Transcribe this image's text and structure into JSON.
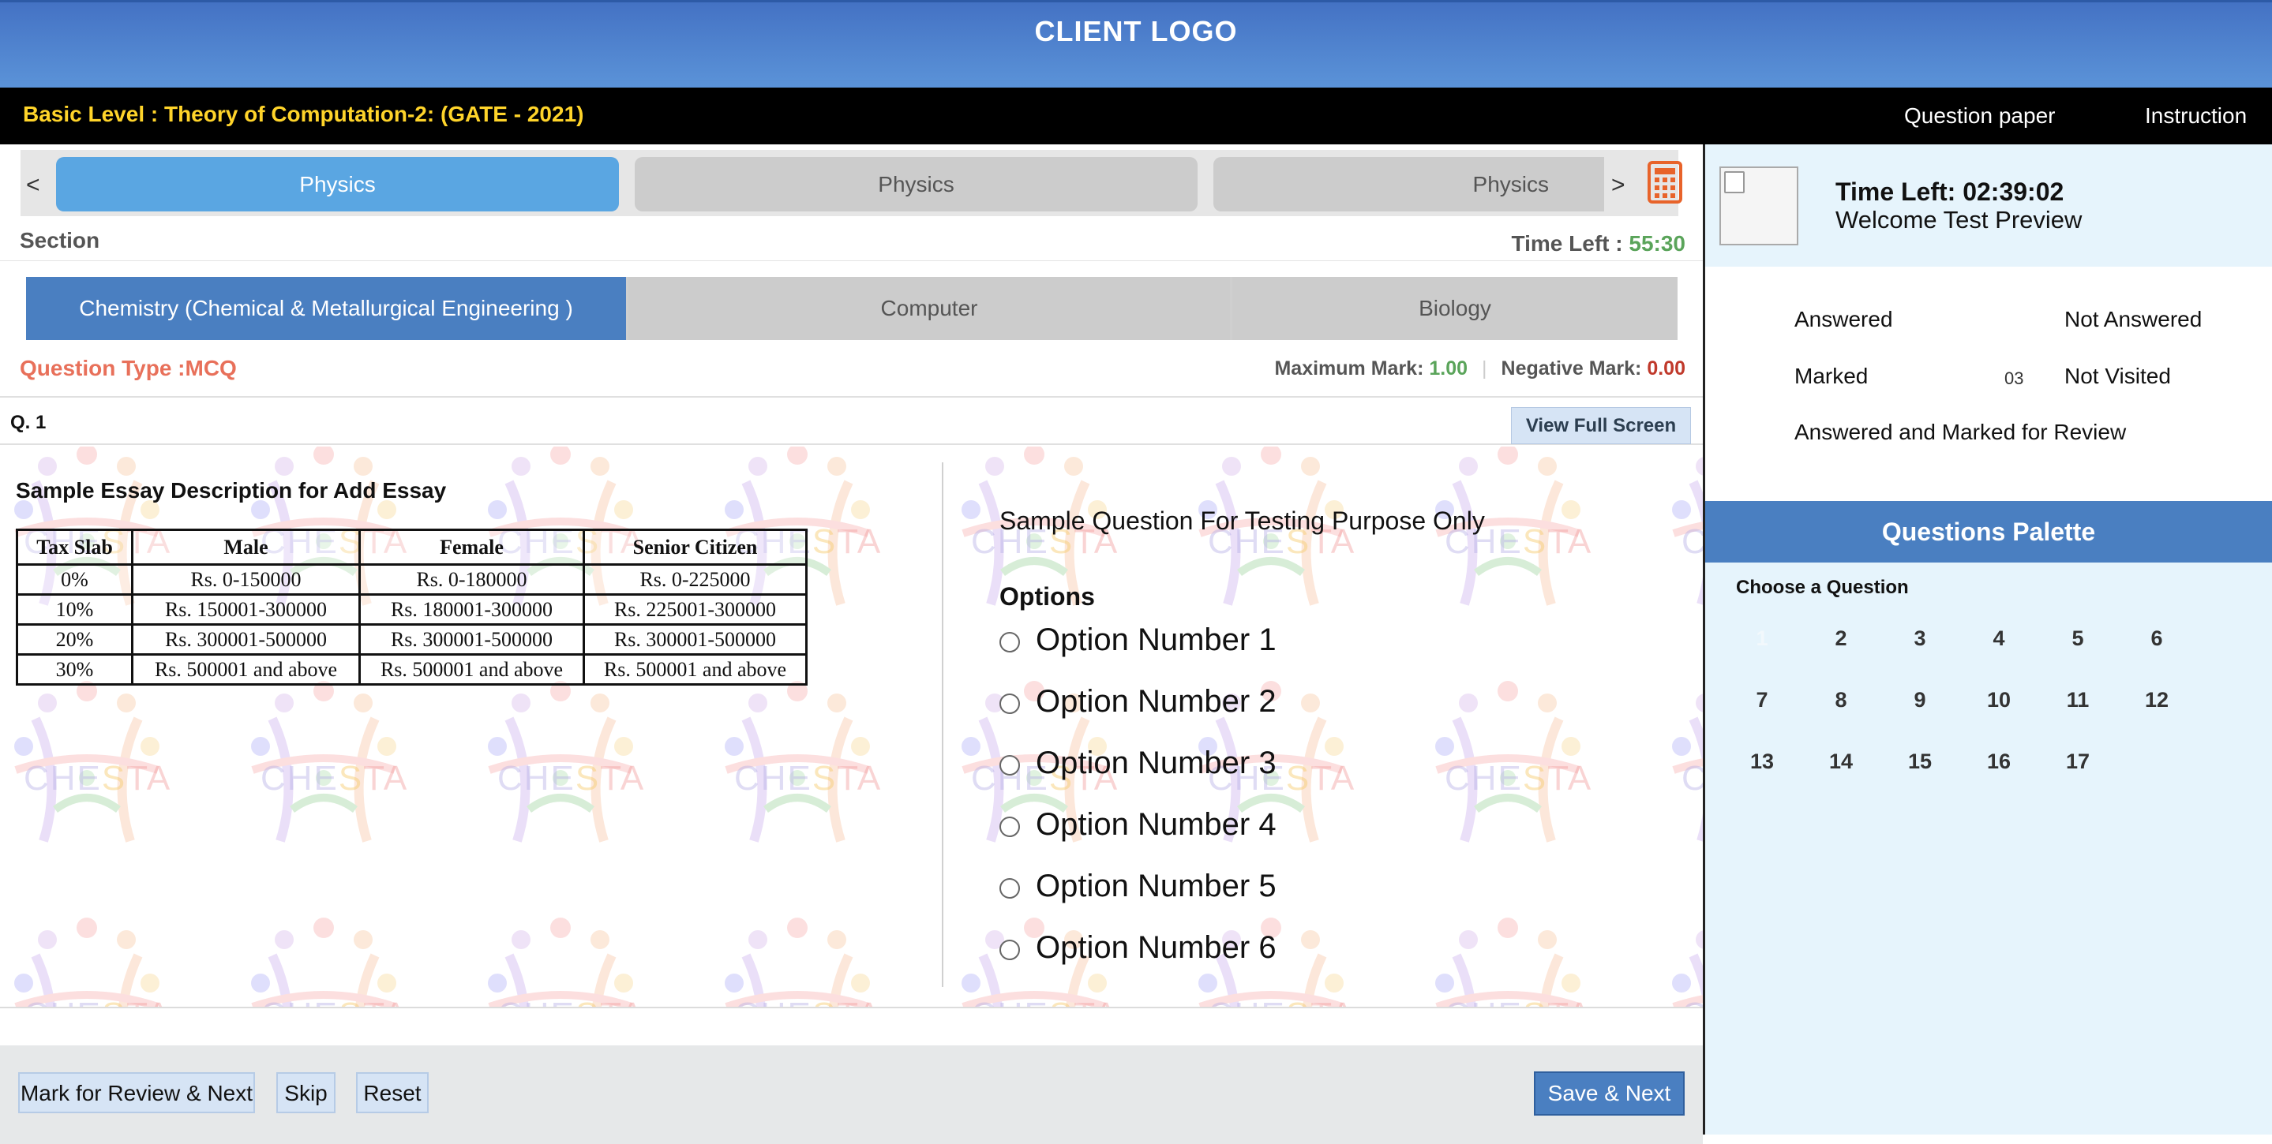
{
  "header": {
    "logo_text": "CLIENT LOGO",
    "exam_title": "Basic Level : Theory of Computation-2: (GATE - 2021)",
    "links": {
      "question_paper": "Question paper",
      "instruction": "Instruction"
    }
  },
  "subjects": {
    "prev": "<",
    "next": ">",
    "tabs": [
      "Physics",
      "Physics",
      "Physics"
    ],
    "active_index": 0
  },
  "section": {
    "label": "Section",
    "time_label": "Time Left : ",
    "time_value": "55:30",
    "tabs": [
      "Chemistry (Chemical & Metallurgical Engineering )",
      "Computer",
      "Biology"
    ],
    "active_index": 0
  },
  "question_meta": {
    "type_label": "Question Type :MCQ",
    "max_mark_label": "Maximum Mark: ",
    "max_mark_value": "1.00",
    "neg_mark_label": "Negative Mark: ",
    "neg_mark_value": "0.00",
    "number": "Q. 1",
    "fullscreen_label": "View Full Screen"
  },
  "essay": {
    "title": "Sample Essay Description for Add Essay",
    "table": {
      "headers": [
        "Tax Slab",
        "Male",
        "Female",
        "Senior Citizen"
      ],
      "rows": [
        [
          "0%",
          "Rs. 0-150000",
          "Rs. 0-180000",
          "Rs. 0-225000"
        ],
        [
          "10%",
          "Rs. 150001-300000",
          "Rs. 180001-300000",
          "Rs. 225001-300000"
        ],
        [
          "20%",
          "Rs. 300001-500000",
          "Rs. 300001-500000",
          "Rs. 300001-500000"
        ],
        [
          "30%",
          "Rs. 500001 and above",
          "Rs. 500001 and above",
          "Rs. 500001 and above"
        ]
      ]
    }
  },
  "question": {
    "text": "Sample Question For Testing Purpose Only",
    "options_heading": "Options",
    "options": [
      "Option Number 1",
      "Option Number 2",
      "Option Number 3",
      "Option Number 4",
      "Option Number 5",
      "Option Number 6"
    ]
  },
  "watermark": {
    "text": "CHESTA"
  },
  "actions": {
    "mark_review": "Mark for Review & Next",
    "skip": "Skip",
    "reset": "Reset",
    "save_next": "Save & Next"
  },
  "candidate": {
    "time_left": "Time Left: 02:39:02",
    "welcome": "Welcome Test Preview"
  },
  "legend": {
    "answered": "Answered",
    "not_answered": "Not Answered",
    "marked": "Marked",
    "marked_count": "03",
    "not_visited": "Not Visited",
    "answered_marked": "Answered and Marked for Review"
  },
  "palette": {
    "title": "Questions Palette",
    "choose_label": "Choose a Question",
    "questions": [
      "1",
      "2",
      "3",
      "4",
      "5",
      "6",
      "7",
      "8",
      "9",
      "10",
      "11",
      "12",
      "13",
      "14",
      "15",
      "16",
      "17"
    ],
    "current": "1"
  },
  "colors": {
    "header_blue": "#4a7fc1",
    "active_tab": "#5aa6e2",
    "title_yellow": "#ffd42a",
    "calculator_orange": "#e8632a",
    "timer_green": "#5aa45a",
    "qtype_red": "#e8705a"
  }
}
